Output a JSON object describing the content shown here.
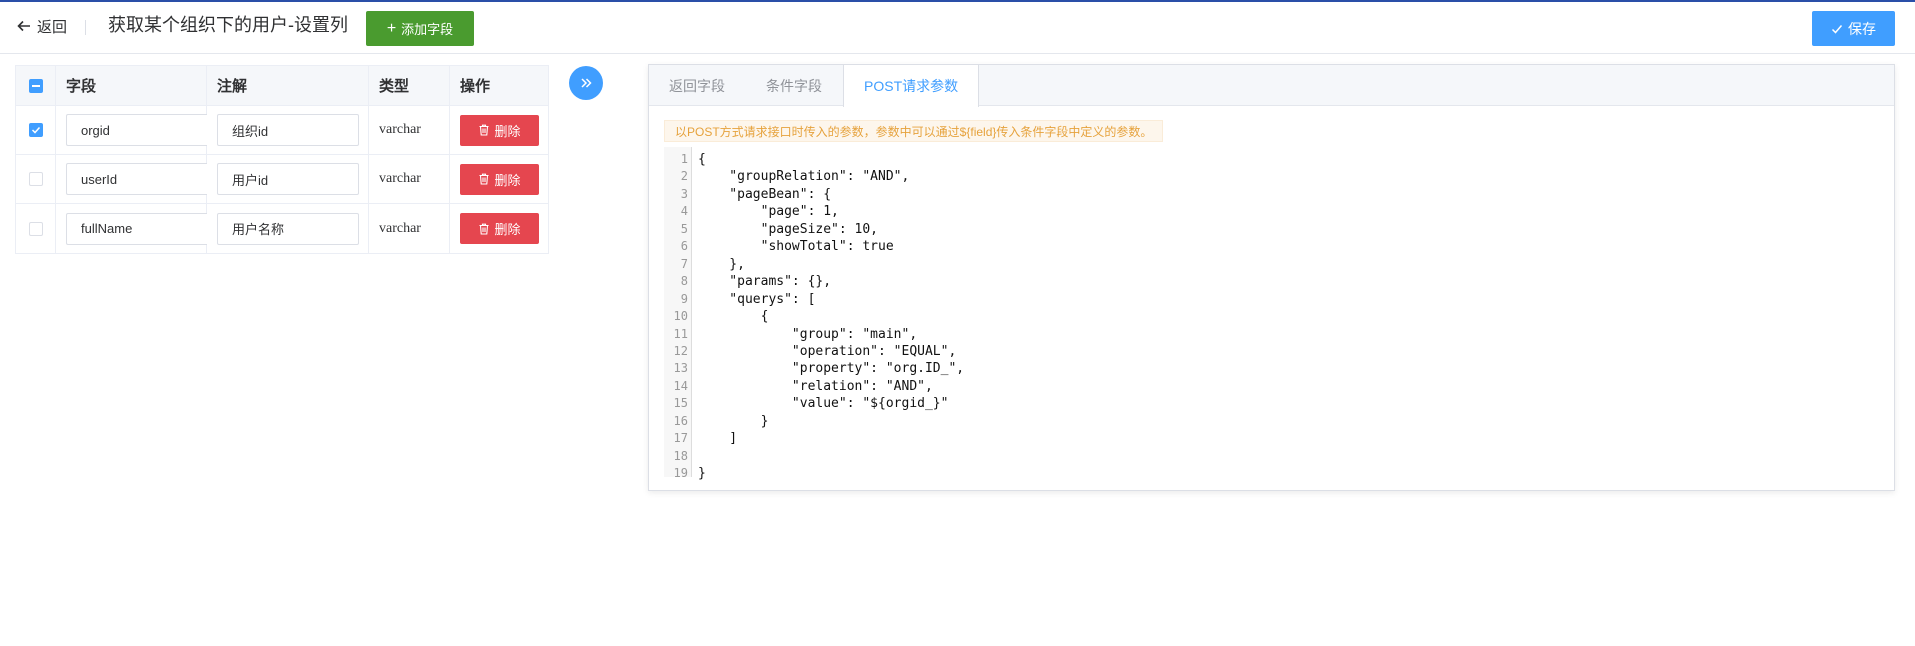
{
  "header": {
    "back_label": "返回",
    "title": "获取某个组织下的用户-设置列",
    "add_field_label": "添加字段",
    "save_label": "保存"
  },
  "table": {
    "columns": [
      "字段",
      "注解",
      "类型",
      "操作"
    ],
    "rows": [
      {
        "checked": true,
        "field": "orgid",
        "comment": "组织id",
        "type": "varchar",
        "action": "删除"
      },
      {
        "checked": false,
        "field": "userId",
        "comment": "用户id",
        "type": "varchar",
        "action": "删除"
      },
      {
        "checked": false,
        "field": "fullName",
        "comment": "用户名称",
        "type": "varchar",
        "action": "删除"
      }
    ]
  },
  "panel": {
    "tabs": [
      "返回字段",
      "条件字段",
      "POST请求参数"
    ],
    "active_tab": 2,
    "notice": "以POST方式请求接口时传入的参数，参数中可以通过${field}传入条件字段中定义的参数。",
    "code_lines": [
      "{",
      "    \"groupRelation\": \"AND\",",
      "    \"pageBean\": {",
      "        \"page\": 1,",
      "        \"pageSize\": 10,",
      "        \"showTotal\": true",
      "    },",
      "    \"params\": {},",
      "    \"querys\": [",
      "        {",
      "            \"group\": \"main\",",
      "            \"operation\": \"EQUAL\",",
      "            \"property\": \"org.ID_\",",
      "            \"relation\": \"AND\",",
      "            \"value\": \"${orgid_}\"",
      "        }",
      "    ]",
      "",
      "}"
    ]
  },
  "icons": {
    "back": "arrow-left-icon",
    "add": "plus-icon",
    "save": "check-icon",
    "delete": "trash-icon",
    "toggle": "double-chevron-right-icon"
  },
  "colors": {
    "primary": "#409eff",
    "success": "#4a9b2f",
    "danger": "#e5464f",
    "warning": "#e6a23c"
  }
}
